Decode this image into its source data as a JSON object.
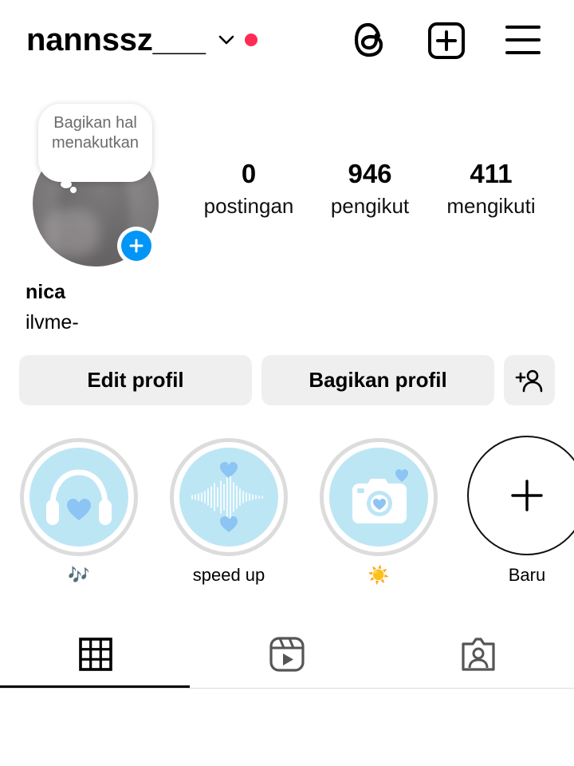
{
  "header": {
    "username": "nannssz___",
    "notification_dot_color": "#fe2c55",
    "icons": [
      "chevron-down-icon",
      "threads-icon",
      "create-post-icon",
      "menu-icon"
    ]
  },
  "note": {
    "text": "Bagikan hal menakutkan"
  },
  "stats": [
    {
      "value": "0",
      "label": "postingan"
    },
    {
      "value": "946",
      "label": "pengikut"
    },
    {
      "value": "411",
      "label": "mengikuti"
    }
  ],
  "profile": {
    "name": "nica",
    "bio": "ilvme-"
  },
  "buttons": {
    "edit": "Edit profil",
    "share": "Bagikan profil",
    "discover_icon": "add-person-icon"
  },
  "highlights": [
    {
      "label": "🎶",
      "icon": "headphones-heart-icon"
    },
    {
      "label": "speed up",
      "icon": "sound-wave-icon"
    },
    {
      "label": "☀️",
      "icon": "camera-heart-icon"
    },
    {
      "label": "Baru",
      "icon": "plus-icon"
    }
  ],
  "tabs": [
    "grid-icon",
    "reels-icon",
    "tagged-icon"
  ],
  "colors": {
    "accent_blue": "#0095f6",
    "highlight_bg": "#bde6f5",
    "highlight_icon": "#8cc4f3",
    "button_bg": "#efefef"
  }
}
